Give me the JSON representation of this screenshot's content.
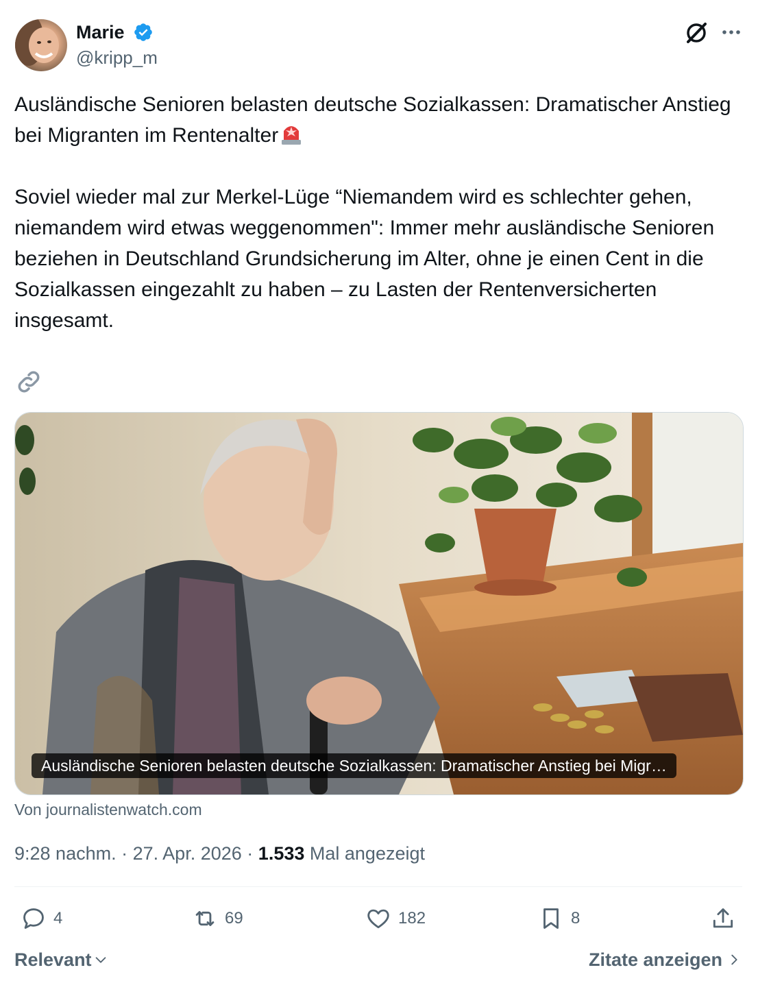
{
  "author": {
    "name": "Marie",
    "handle": "@kripp_m",
    "verified": true,
    "verified_color": "#1d9bf0"
  },
  "header_icons": [
    "grok-icon",
    "more-icon"
  ],
  "tweet": {
    "text_p1": "Ausländische Senioren belasten deutsche Sozialkassen: Dramatischer Anstieg bei Migranten im Rentenalter",
    "emoji": "police-light-emoji",
    "text_p2": "Soviel wieder mal zur Merkel-Lüge “Niemandem wird es schlechter gehen, niemandem wird etwas weggenommen\": Immer mehr ausländische Senioren beziehen in Deutschland Grundsicherung im Alter, ohne je einen Cent in die Sozialkassen eingezahlt zu haben – zu Lasten der Rentenversicherten insgesamt."
  },
  "link_card": {
    "caption": "Ausländische Senioren belasten deutsche Sozialkassen: Dramatischer Anstieg bei Migr…",
    "source": "Von journalistenwatch.com"
  },
  "meta": {
    "time": "9:28 nachm.",
    "date": "27. Apr. 2026",
    "separator": "·",
    "views_count": "1.533",
    "views_label": "Mal angezeigt"
  },
  "actions": {
    "replies": "4",
    "reposts": "69",
    "likes": "182",
    "bookmarks": "8"
  },
  "footer": {
    "sort_label": "Relevant",
    "quotes_label": "Zitate anzeigen"
  },
  "colors": {
    "text": "#0f1419",
    "secondary": "#536471",
    "border": "#cfd9de"
  }
}
